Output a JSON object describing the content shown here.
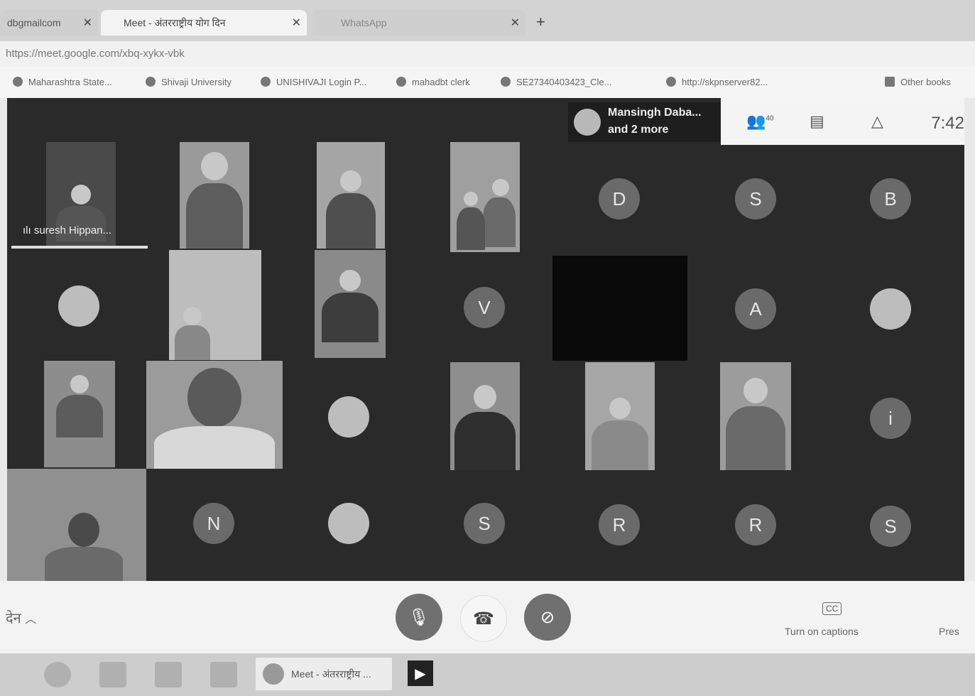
{
  "browser": {
    "tabs": [
      {
        "label": "dbgmailcom"
      },
      {
        "label": "Meet - अंतरराष्ट्रीय योग दिन"
      },
      {
        "label": "WhatsApp"
      }
    ],
    "url": "https://meet.google.com/xbq-xykx-vbk",
    "bookmarks": [
      "Maharashtra State...",
      "Shivaji University",
      "UNISHIVAJI Login P...",
      "mahadbt clerk",
      "SE27340403423_Cle...",
      "http://skpnserver82...",
      "Other books"
    ]
  },
  "meet": {
    "presenter": {
      "name": "Mansingh Daba...",
      "more": "and 2 more"
    },
    "time": "7:42",
    "participants_count": "40",
    "active_speaker": "suresh Hippan...",
    "avatars": [
      "D",
      "S",
      "B",
      "V",
      "A",
      "i",
      "N",
      "S",
      "R",
      "R",
      "S"
    ]
  },
  "controls": {
    "meeting_name": "देन",
    "captions_label": "Turn on captions",
    "cc_label": "CC",
    "present_label": "Pres"
  },
  "taskbar": {
    "meet_label": "Meet - अंतरराष्ट्रीय ..."
  },
  "colors": {
    "meet_bg": "#2a2a2a",
    "avatar_bg": "#6a6a6a"
  }
}
